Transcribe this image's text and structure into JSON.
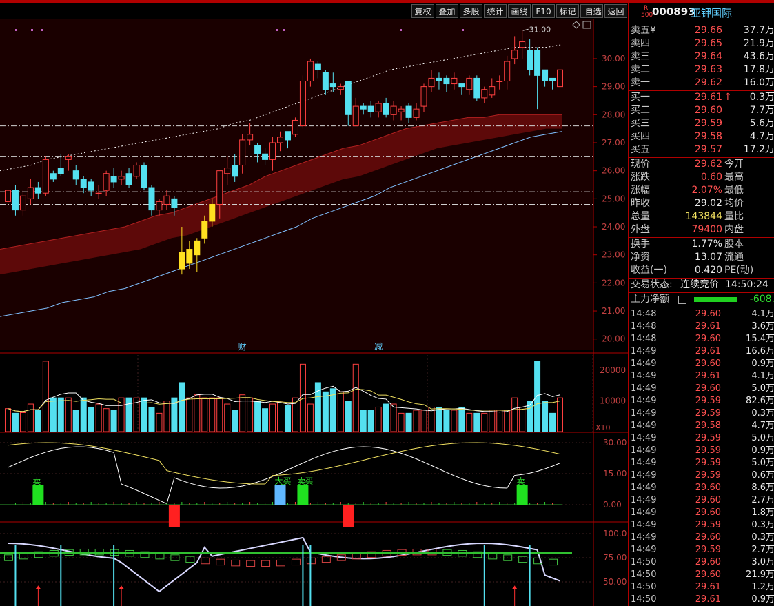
{
  "toolbar": {
    "buttons": [
      "复权",
      "叠加",
      "多股",
      "统计",
      "画线",
      "F10",
      "标记",
      "-自选",
      "返回"
    ]
  },
  "stock": {
    "code": "000893",
    "name": "亚钾国际",
    "badge_r": "R",
    "badge_num": "500"
  },
  "orderbook": {
    "asks": [
      {
        "label": "卖五¥",
        "price": "29.66",
        "vol": "37.7万"
      },
      {
        "label": "卖四",
        "price": "29.65",
        "vol": "21.9万"
      },
      {
        "label": "卖三",
        "price": "29.64",
        "vol": "43.6万"
      },
      {
        "label": "卖二",
        "price": "29.63",
        "vol": "17.8万"
      },
      {
        "label": "卖一",
        "price": "29.62",
        "vol": "16.0万"
      }
    ],
    "bids": [
      {
        "label": "买一",
        "price": "29.61",
        "vol": "0.3万",
        "arrow": "↑"
      },
      {
        "label": "买二",
        "price": "29.60",
        "vol": "7.7万"
      },
      {
        "label": "买三",
        "price": "29.59",
        "vol": "5.6万"
      },
      {
        "label": "买四",
        "price": "29.58",
        "vol": "4.7万"
      },
      {
        "label": "买五",
        "price": "29.57",
        "vol": "17.2万"
      }
    ]
  },
  "quote": [
    {
      "l1": "现价",
      "v1": "29.62",
      "c1": "red",
      "l2": "今开"
    },
    {
      "l1": "涨跌",
      "v1": "0.60",
      "c1": "red",
      "l2": "最高"
    },
    {
      "l1": "涨幅",
      "v1": "2.07%",
      "c1": "red",
      "l2": "最低"
    },
    {
      "l1": "昨收",
      "v1": "29.02",
      "c1": "white",
      "l2": "均价"
    },
    {
      "l1": "总量",
      "v1": "143844",
      "c1": "yellow",
      "l2": "量比"
    },
    {
      "l1": "外盘",
      "v1": "79400",
      "c1": "red",
      "l2": "内盘"
    }
  ],
  "fundamentals": [
    {
      "l1": "换手",
      "v1": "1.77%",
      "l2": "股本"
    },
    {
      "l1": "净资",
      "v1": "13.07",
      "l2": "流通"
    },
    {
      "l1": "收益(一)",
      "v1": "0.420",
      "l2": "PE(动)"
    }
  ],
  "trade_status": {
    "label": "交易状态:",
    "value": "连续竞价",
    "time": "14:50:24"
  },
  "main_force": {
    "label": "主力净额",
    "value": "-608."
  },
  "ticks": [
    {
      "t": "14:48",
      "p": "29.60",
      "v": "4.1万"
    },
    {
      "t": "14:48",
      "p": "29.61",
      "v": "3.6万"
    },
    {
      "t": "14:48",
      "p": "29.60",
      "v": "15.4万"
    },
    {
      "t": "14:49",
      "p": "29.61",
      "v": "16.6万"
    },
    {
      "t": "14:49",
      "p": "29.60",
      "v": "0.9万"
    },
    {
      "t": "14:49",
      "p": "29.61",
      "v": "4.1万"
    },
    {
      "t": "14:49",
      "p": "29.60",
      "v": "5.0万"
    },
    {
      "t": "14:49",
      "p": "29.59",
      "v": "82.6万"
    },
    {
      "t": "14:49",
      "p": "29.59",
      "v": "0.3万"
    },
    {
      "t": "14:49",
      "p": "29.58",
      "v": "4.7万"
    },
    {
      "t": "14:49",
      "p": "29.59",
      "v": "5.0万"
    },
    {
      "t": "14:49",
      "p": "29.59",
      "v": "0.9万"
    },
    {
      "t": "14:49",
      "p": "29.59",
      "v": "5.0万"
    },
    {
      "t": "14:49",
      "p": "29.59",
      "v": "0.6万"
    },
    {
      "t": "14:49",
      "p": "29.60",
      "v": "8.6万"
    },
    {
      "t": "14:49",
      "p": "29.60",
      "v": "2.7万"
    },
    {
      "t": "14:49",
      "p": "29.60",
      "v": "1.8万"
    },
    {
      "t": "14:49",
      "p": "29.59",
      "v": "0.3万"
    },
    {
      "t": "14:49",
      "p": "29.60",
      "v": "0.3万"
    },
    {
      "t": "14:49",
      "p": "29.59",
      "v": "2.7万"
    },
    {
      "t": "14:50",
      "p": "29.60",
      "v": "3.0万"
    },
    {
      "t": "14:50",
      "p": "29.60",
      "v": "21.9万"
    },
    {
      "t": "14:50",
      "p": "29.61",
      "v": "1.2万"
    },
    {
      "t": "14:50",
      "p": "29.61",
      "v": "0.9万"
    }
  ],
  "chart_data": [
    {
      "type": "candlestick",
      "price_axis_ticks": [
        "30.00",
        "29.00",
        "28.00",
        "27.00",
        "26.00",
        "25.00",
        "24.00",
        "23.00",
        "22.00",
        "21.00",
        "20.00"
      ],
      "ylim": [
        19.6,
        31.4
      ],
      "high_annotation": "31.00",
      "markers": [
        {
          "text": "财",
          "index": 31
        },
        {
          "text": "减",
          "index": 49
        }
      ],
      "candles": [
        [
          24.9,
          25.3,
          24.6,
          25.1
        ],
        [
          25.3,
          24.6,
          24.4,
          25.5
        ],
        [
          24.6,
          25.1,
          24.4,
          25.3
        ],
        [
          25.0,
          25.4,
          24.8,
          25.7
        ],
        [
          25.4,
          25.2,
          25.0,
          25.6
        ],
        [
          25.2,
          26.4,
          25.1,
          26.5
        ],
        [
          25.9,
          25.7,
          25.6,
          26.0
        ],
        [
          26.1,
          25.9,
          25.8,
          26.6
        ],
        [
          26.4,
          26.5,
          26.0,
          26.6
        ],
        [
          26.0,
          25.7,
          25.5,
          26.2
        ],
        [
          25.7,
          25.4,
          25.2,
          25.8
        ],
        [
          25.6,
          25.3,
          25.1,
          25.7
        ],
        [
          25.2,
          25.2,
          25.0,
          25.5
        ],
        [
          25.3,
          25.9,
          25.1,
          26.0
        ],
        [
          25.8,
          25.6,
          25.4,
          26.1
        ],
        [
          25.7,
          25.8,
          25.5,
          26.0
        ],
        [
          25.9,
          25.5,
          25.4,
          26.1
        ],
        [
          25.8,
          26.2,
          25.7,
          26.3
        ],
        [
          26.2,
          25.4,
          25.3,
          26.3
        ],
        [
          25.4,
          24.6,
          24.4,
          25.5
        ],
        [
          24.6,
          24.9,
          24.4,
          25.0
        ],
        [
          24.8,
          25.1,
          24.6,
          25.3
        ],
        [
          25.0,
          24.7,
          24.4,
          25.1
        ],
        [
          23.1,
          22.5,
          22.3,
          24.0
        ],
        [
          22.7,
          23.2,
          22.5,
          23.5
        ],
        [
          23.0,
          23.5,
          22.4,
          23.6
        ],
        [
          23.6,
          24.2,
          23.4,
          24.4
        ],
        [
          24.2,
          24.8,
          24.0,
          25.0
        ],
        [
          24.8,
          26.0,
          24.3,
          26.0
        ],
        [
          25.9,
          26.1,
          25.5,
          26.5
        ],
        [
          26.2,
          25.8,
          25.6,
          26.6
        ],
        [
          26.2,
          27.1,
          25.9,
          27.3
        ],
        [
          27.1,
          27.3,
          26.9,
          27.7
        ],
        [
          26.9,
          26.6,
          26.3,
          27.0
        ],
        [
          26.6,
          26.4,
          26.2,
          26.8
        ],
        [
          26.4,
          27.0,
          26.0,
          27.2
        ],
        [
          27.0,
          27.2,
          26.7,
          27.4
        ],
        [
          27.4,
          27.1,
          26.8,
          27.4
        ],
        [
          27.3,
          27.8,
          27.2,
          27.9
        ],
        [
          27.6,
          29.2,
          27.5,
          29.4
        ],
        [
          29.2,
          29.9,
          29.0,
          30.0
        ],
        [
          29.8,
          29.6,
          29.3,
          29.9
        ],
        [
          29.5,
          28.9,
          28.7,
          29.6
        ],
        [
          29.1,
          29.0,
          28.8,
          29.5
        ],
        [
          28.9,
          29.0,
          28.7,
          29.1
        ],
        [
          29.2,
          28.0,
          27.6,
          29.2
        ],
        [
          27.6,
          28.3,
          27.6,
          28.6
        ],
        [
          28.3,
          28.2,
          28.0,
          28.4
        ],
        [
          28.3,
          28.1,
          27.9,
          28.5
        ],
        [
          28.1,
          28.4,
          27.9,
          28.5
        ],
        [
          28.4,
          28.0,
          27.9,
          28.6
        ],
        [
          28.0,
          28.3,
          27.8,
          28.5
        ],
        [
          28.1,
          28.2,
          27.8,
          28.3
        ],
        [
          28.3,
          27.9,
          27.7,
          28.4
        ],
        [
          27.9,
          28.2,
          27.8,
          28.4
        ],
        [
          28.3,
          29.0,
          28.1,
          29.1
        ],
        [
          29.0,
          29.3,
          28.8,
          29.6
        ],
        [
          29.3,
          29.2,
          28.9,
          29.5
        ],
        [
          29.3,
          29.1,
          28.8,
          29.4
        ],
        [
          29.1,
          29.3,
          28.9,
          29.5
        ],
        [
          29.1,
          29.0,
          28.7,
          29.1
        ],
        [
          28.9,
          29.3,
          28.7,
          29.4
        ],
        [
          29.3,
          28.6,
          28.5,
          29.4
        ],
        [
          28.6,
          28.9,
          28.4,
          29.0
        ],
        [
          28.7,
          29.0,
          28.6,
          29.3
        ],
        [
          29.2,
          29.2,
          28.9,
          29.4
        ],
        [
          29.2,
          29.9,
          28.9,
          30.1
        ],
        [
          30.0,
          30.3,
          29.8,
          30.8
        ],
        [
          30.4,
          30.6,
          30.0,
          31.0
        ],
        [
          30.3,
          29.6,
          29.4,
          30.7
        ],
        [
          30.3,
          29.4,
          28.2,
          30.4
        ],
        [
          29.6,
          29.2,
          29.0,
          29.6
        ],
        [
          29.3,
          29.2,
          28.9,
          29.3
        ],
        [
          29.0,
          29.6,
          28.8,
          29.7
        ]
      ],
      "ma_dotted": [
        26.0,
        26.1,
        26.2,
        26.4,
        26.5,
        26.6,
        26.7,
        26.8,
        26.9,
        27.0,
        27.1,
        27.2,
        27.3,
        27.4,
        27.5,
        27.7,
        27.8,
        28.0,
        28.2,
        28.4,
        28.6,
        28.8,
        29.0,
        29.2,
        29.4,
        29.6,
        29.7,
        29.8,
        29.9,
        30.0,
        30.1,
        30.2,
        30.3,
        30.4,
        30.4,
        30.4,
        30.5
      ],
      "band_upper": [
        23.2,
        23.3,
        23.4,
        23.5,
        23.6,
        23.7,
        23.8,
        23.9,
        24.0,
        24.2,
        24.4,
        24.5,
        24.7,
        24.9,
        25.1,
        25.3,
        25.5,
        25.8,
        26.0,
        26.2,
        26.4,
        26.6,
        26.8,
        26.9,
        27.1,
        27.3,
        27.5,
        27.6,
        27.7,
        27.8,
        27.9,
        27.9,
        28.0,
        28.0,
        28.0,
        28.0,
        28.0
      ],
      "band_lower": [
        22.3,
        22.4,
        22.5,
        22.6,
        22.7,
        22.8,
        22.9,
        23.0,
        23.1,
        23.2,
        23.4,
        23.6,
        23.7,
        23.9,
        24.1,
        24.3,
        24.5,
        24.7,
        24.9,
        25.1,
        25.3,
        25.5,
        25.7,
        25.8,
        26.0,
        26.2,
        26.4,
        26.6,
        26.8,
        26.9,
        27.0,
        27.1,
        27.2,
        27.3,
        27.4,
        27.5,
        27.5
      ],
      "ma_lower": [
        20.8,
        20.9,
        21.0,
        21.1,
        21.3,
        21.4,
        21.5,
        21.7,
        21.8,
        22.0,
        22.2,
        22.4,
        22.6,
        22.8,
        23.0,
        23.2,
        23.4,
        23.6,
        23.8,
        24.0,
        24.3,
        24.5,
        24.7,
        24.9,
        25.1,
        25.4,
        25.6,
        25.8,
        26.0,
        26.2,
        26.4,
        26.6,
        26.8,
        27.0,
        27.2,
        27.3,
        27.4
      ],
      "hlines": [
        27.6,
        26.5,
        25.25,
        24.8
      ]
    },
    {
      "type": "bar",
      "name": "volume",
      "axis_ticks": [
        "20000",
        "10000"
      ],
      "axis_unit": "X10",
      "ylim": [
        0,
        25000
      ],
      "values": [
        7500,
        6000,
        6200,
        9000,
        7000,
        23000,
        11000,
        11000,
        11000,
        7000,
        11000,
        8000,
        9000,
        7500,
        7000,
        11000,
        11000,
        11000,
        11000,
        8000,
        6000,
        10000,
        11000,
        16000,
        11000,
        12000,
        11000,
        11000,
        11000,
        9000,
        7000,
        12000,
        11000,
        10000,
        7500,
        9000,
        10000,
        8500,
        11000,
        22000,
        9000,
        16000,
        13000,
        14000,
        13000,
        10000,
        22000,
        7000,
        7000,
        8000,
        9000,
        9000,
        6000,
        6000,
        7000,
        7000,
        8000,
        8000,
        7000,
        7000,
        8000,
        6000,
        6000,
        6000,
        7000,
        7000,
        7000,
        11000,
        8000,
        10000,
        23000,
        10000,
        6000,
        11000
      ]
    },
    {
      "type": "line",
      "name": "indicator1",
      "axis_ticks": [
        "30.00",
        "15.00",
        "0.00"
      ],
      "ylim": [
        -8,
        34
      ],
      "labels": [
        {
          "text": "卖",
          "index": 4
        },
        {
          "text": "大买",
          "index": 36
        },
        {
          "text": "卖",
          "index": 39
        },
        {
          "text": "买",
          "index": 40
        },
        {
          "text": "卖",
          "index": 68
        }
      ]
    },
    {
      "type": "line",
      "name": "indicator2",
      "axis_ticks": [
        "100.0",
        "75.00",
        "50.00"
      ],
      "ylim": [
        25,
        110
      ]
    }
  ]
}
